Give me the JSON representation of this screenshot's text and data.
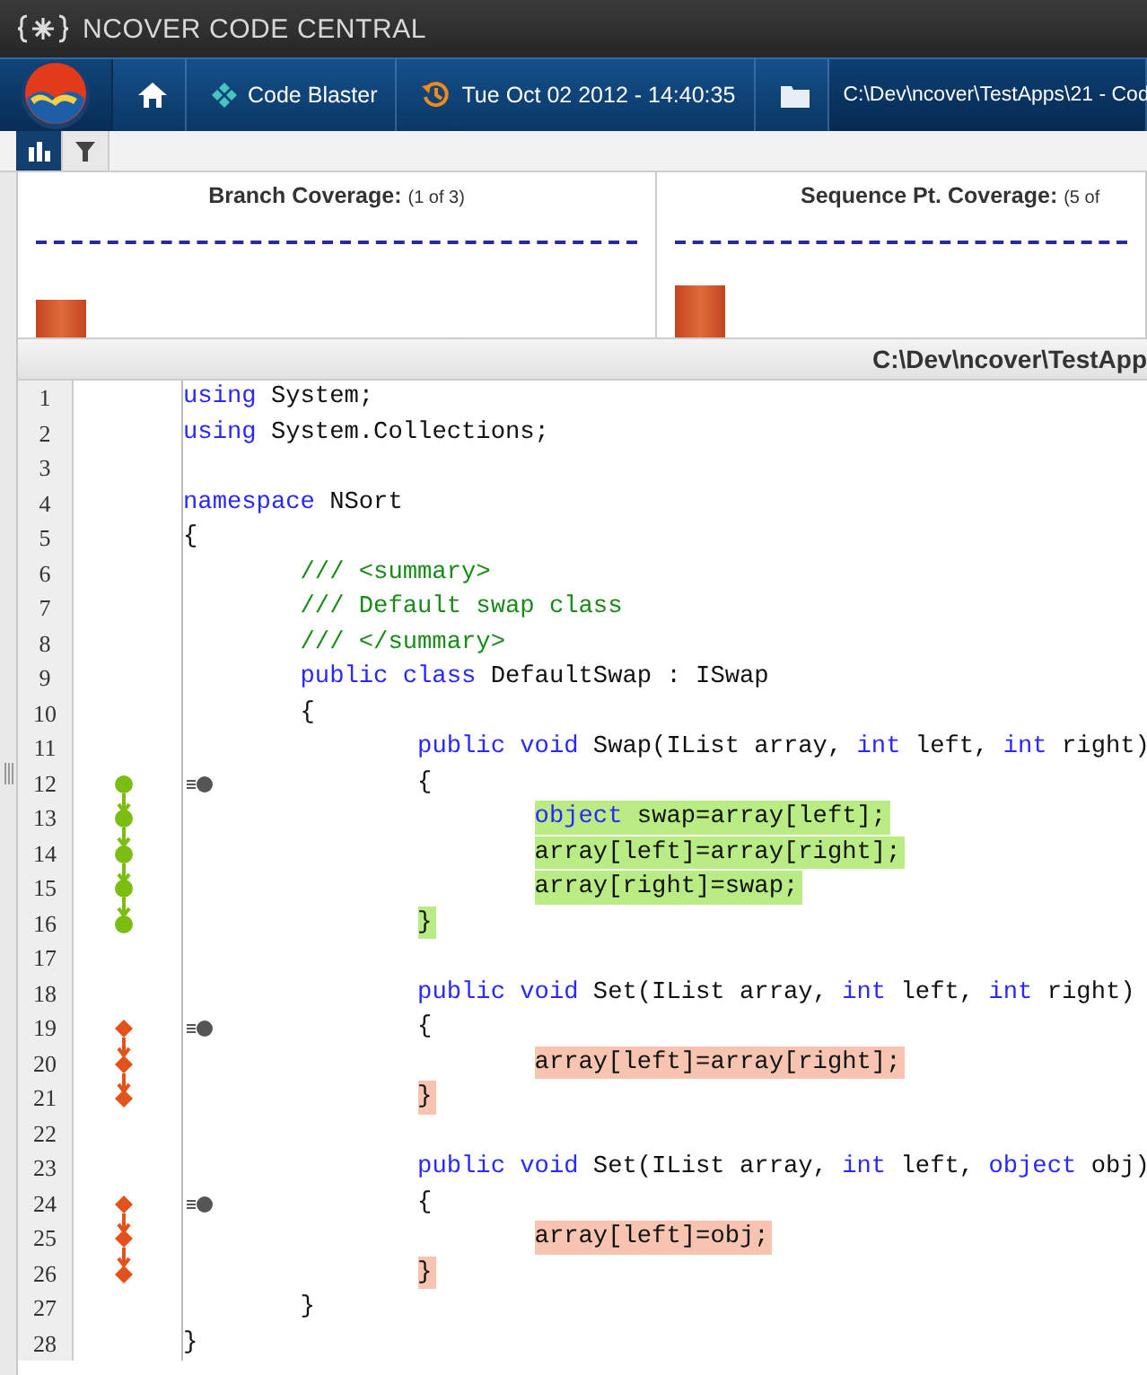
{
  "title_bar": {
    "title": "NCOVER CODE CENTRAL"
  },
  "breadcrumbs": [
    {
      "kind": "home"
    },
    {
      "kind": "project",
      "label": "Code Blaster"
    },
    {
      "kind": "history",
      "label": "Tue Oct 02 2012 - 14:40:35"
    },
    {
      "kind": "folder"
    },
    {
      "kind": "path",
      "label": "C:\\Dev\\ncover\\TestApps\\21 - Cod"
    }
  ],
  "view_tabs": [
    {
      "kind": "chart",
      "selected": true
    },
    {
      "kind": "filter",
      "selected": false
    }
  ],
  "coverage_panels": [
    {
      "title": "Branch Coverage:",
      "count": "(1 of 3)"
    },
    {
      "title": "Sequence Pt. Coverage:",
      "count": "(5 of"
    }
  ],
  "file_header": "C:\\Dev\\ncover\\TestApp",
  "lines": [
    {
      "number": "1",
      "kind": "plain",
      "entry": false,
      "highlighted": false,
      "tokens": [
        {
          "kind": "keyword",
          "text": "using"
        },
        {
          "kind": "plain",
          "text": " System;"
        }
      ]
    },
    {
      "number": "2",
      "kind": "plain",
      "entry": false,
      "highlighted": false,
      "tokens": [
        {
          "kind": "keyword",
          "text": "using"
        },
        {
          "kind": "plain",
          "text": " System.Collections;"
        }
      ]
    },
    {
      "number": "3",
      "kind": "plain",
      "entry": false,
      "highlighted": false
    },
    {
      "number": "4",
      "kind": "plain",
      "entry": false,
      "highlighted": false,
      "tokens": [
        {
          "kind": "keyword",
          "text": "namespace"
        },
        {
          "kind": "plain",
          "text": " NSort"
        }
      ]
    },
    {
      "number": "5",
      "kind": "plain",
      "entry": false,
      "highlighted": false,
      "tokens": [
        {
          "kind": "plain",
          "text": "{"
        }
      ]
    },
    {
      "number": "6",
      "kind": "plain",
      "entry": false,
      "highlighted": false,
      "tokens": [
        {
          "kind": "comment",
          "text": "        /// <summary>"
        }
      ]
    },
    {
      "number": "7",
      "kind": "plain",
      "entry": false,
      "highlighted": false,
      "tokens": [
        {
          "kind": "comment",
          "text": "        /// Default swap class"
        }
      ]
    },
    {
      "number": "8",
      "kind": "plain",
      "entry": false,
      "highlighted": false,
      "tokens": [
        {
          "kind": "comment",
          "text": "        /// </summary>"
        }
      ]
    },
    {
      "number": "9",
      "kind": "plain",
      "entry": false,
      "highlighted": false,
      "tokens": [
        {
          "kind": "keyword",
          "text": "        public class"
        },
        {
          "kind": "plain",
          "text": " DefaultSwap : ISwap"
        }
      ]
    },
    {
      "number": "10",
      "kind": "plain",
      "entry": false,
      "highlighted": false,
      "tokens": [
        {
          "kind": "plain",
          "text": "        {"
        }
      ]
    },
    {
      "number": "11",
      "kind": "plain",
      "entry": false,
      "highlighted": false,
      "tokens": [
        {
          "kind": "keyword",
          "text": "                public void"
        },
        {
          "kind": "plain",
          "text": " Swap(IList array, "
        },
        {
          "kind": "keyword",
          "text": "int"
        },
        {
          "kind": "plain",
          "text": " left, "
        },
        {
          "kind": "keyword",
          "text": "int"
        },
        {
          "kind": "plain",
          "text": " right)"
        }
      ]
    },
    {
      "number": "12",
      "kind": "covered",
      "entry": true,
      "highlighted": false,
      "tokens": [
        {
          "kind": "plain",
          "text": "                {"
        }
      ]
    },
    {
      "number": "13",
      "kind": "covered",
      "entry": false,
      "highlighted": true,
      "tokens": [
        {
          "kind": "keyword",
          "text": "                        object"
        },
        {
          "kind": "plain",
          "text": " swap=array[left];"
        }
      ]
    },
    {
      "number": "14",
      "kind": "covered",
      "entry": false,
      "highlighted": true,
      "tokens": [
        {
          "kind": "plain",
          "text": "                        array[left]=array[right];"
        }
      ]
    },
    {
      "number": "15",
      "kind": "covered",
      "entry": false,
      "highlighted": true,
      "tokens": [
        {
          "kind": "plain",
          "text": "                        array[right]=swap;"
        }
      ]
    },
    {
      "number": "16",
      "kind": "covered",
      "entry": false,
      "highlighted": true,
      "tokens": [
        {
          "kind": "plain",
          "text": "                }"
        }
      ]
    },
    {
      "number": "17",
      "kind": "plain",
      "entry": false,
      "highlighted": false
    },
    {
      "number": "18",
      "kind": "plain",
      "entry": false,
      "highlighted": false,
      "tokens": [
        {
          "kind": "keyword",
          "text": "                public void"
        },
        {
          "kind": "plain",
          "text": " Set(IList array, "
        },
        {
          "kind": "keyword",
          "text": "int"
        },
        {
          "kind": "plain",
          "text": " left, "
        },
        {
          "kind": "keyword",
          "text": "int"
        },
        {
          "kind": "plain",
          "text": " right)"
        }
      ]
    },
    {
      "number": "19",
      "kind": "uncovered",
      "entry": true,
      "highlighted": false,
      "tokens": [
        {
          "kind": "plain",
          "text": "                {"
        }
      ]
    },
    {
      "number": "20",
      "kind": "uncovered",
      "entry": false,
      "highlighted": true,
      "tokens": [
        {
          "kind": "plain",
          "text": "                        array[left]=array[right];"
        }
      ]
    },
    {
      "number": "21",
      "kind": "uncovered",
      "entry": false,
      "highlighted": true,
      "tokens": [
        {
          "kind": "plain",
          "text": "                }"
        }
      ]
    },
    {
      "number": "22",
      "kind": "plain",
      "entry": false,
      "highlighted": false
    },
    {
      "number": "23",
      "kind": "plain",
      "entry": false,
      "highlighted": false,
      "tokens": [
        {
          "kind": "keyword",
          "text": "                public void"
        },
        {
          "kind": "plain",
          "text": " Set(IList array, "
        },
        {
          "kind": "keyword",
          "text": "int"
        },
        {
          "kind": "plain",
          "text": " left, "
        },
        {
          "kind": "keyword",
          "text": "object"
        },
        {
          "kind": "plain",
          "text": " obj)"
        }
      ]
    },
    {
      "number": "24",
      "kind": "uncovered",
      "entry": true,
      "highlighted": false,
      "tokens": [
        {
          "kind": "plain",
          "text": "                {"
        }
      ]
    },
    {
      "number": "25",
      "kind": "uncovered",
      "entry": false,
      "highlighted": true,
      "tokens": [
        {
          "kind": "plain",
          "text": "                        array[left]=obj;"
        }
      ]
    },
    {
      "number": "26",
      "kind": "uncovered",
      "entry": false,
      "highlighted": true,
      "tokens": [
        {
          "kind": "plain",
          "text": "                }"
        }
      ]
    },
    {
      "number": "27",
      "kind": "plain",
      "entry": false,
      "highlighted": false,
      "tokens": [
        {
          "kind": "plain",
          "text": "        }"
        }
      ]
    },
    {
      "number": "28",
      "kind": "plain",
      "entry": false,
      "highlighted": false,
      "tokens": [
        {
          "kind": "plain",
          "text": "}"
        }
      ]
    }
  ]
}
